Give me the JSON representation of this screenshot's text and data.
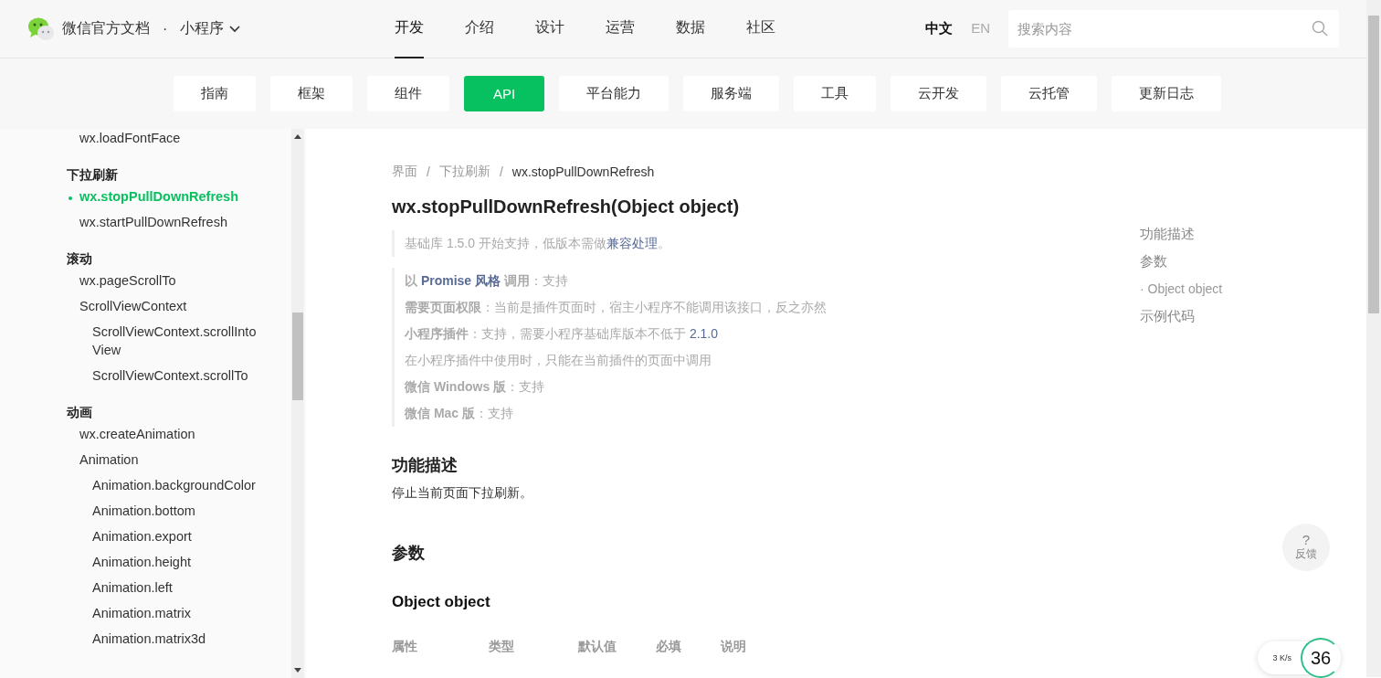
{
  "header": {
    "site_title": "微信官方文档",
    "separator": "·",
    "product": "小程序",
    "nav": [
      {
        "label": "开发",
        "selected": true
      },
      {
        "label": "介绍",
        "selected": false
      },
      {
        "label": "设计",
        "selected": false
      },
      {
        "label": "运营",
        "selected": false
      },
      {
        "label": "数据",
        "selected": false
      },
      {
        "label": "社区",
        "selected": false
      }
    ],
    "languages": [
      {
        "label": "中文",
        "selected": true
      },
      {
        "label": "EN",
        "selected": false
      }
    ],
    "search": {
      "placeholder": "搜索内容"
    }
  },
  "subnav": [
    {
      "label": "指南",
      "selected": false
    },
    {
      "label": "框架",
      "selected": false
    },
    {
      "label": "组件",
      "selected": false
    },
    {
      "label": "API",
      "selected": true
    },
    {
      "label": "平台能力",
      "selected": false
    },
    {
      "label": "服务端",
      "selected": false
    },
    {
      "label": "工具",
      "selected": false
    },
    {
      "label": "云开发",
      "selected": false
    },
    {
      "label": "云托管",
      "selected": false
    },
    {
      "label": "更新日志",
      "selected": false
    }
  ],
  "sidebar": {
    "items": [
      {
        "kind": "item",
        "label": "wx.loadFontFace",
        "selected": false
      },
      {
        "kind": "group",
        "label": "下拉刷新",
        "children": [
          {
            "kind": "item",
            "label": "wx.stopPullDownRefresh",
            "selected": true
          },
          {
            "kind": "item",
            "label": "wx.startPullDownRefresh",
            "selected": false
          }
        ]
      },
      {
        "kind": "group",
        "label": "滚动",
        "children": [
          {
            "kind": "item",
            "label": "wx.pageScrollTo",
            "selected": false
          },
          {
            "kind": "item",
            "label": "ScrollViewContext",
            "selected": false,
            "children": [
              {
                "kind": "item",
                "label": "ScrollViewContext.scrollIntoView",
                "selected": false
              },
              {
                "kind": "item",
                "label": "ScrollViewContext.scrollTo",
                "selected": false
              }
            ]
          }
        ]
      },
      {
        "kind": "group",
        "label": "动画",
        "children": [
          {
            "kind": "item",
            "label": "wx.createAnimation",
            "selected": false
          },
          {
            "kind": "item",
            "label": "Animation",
            "selected": false,
            "children": [
              {
                "kind": "item",
                "label": "Animation.backgroundColor",
                "selected": false
              },
              {
                "kind": "item",
                "label": "Animation.bottom",
                "selected": false
              },
              {
                "kind": "item",
                "label": "Animation.export",
                "selected": false
              },
              {
                "kind": "item",
                "label": "Animation.height",
                "selected": false
              },
              {
                "kind": "item",
                "label": "Animation.left",
                "selected": false
              },
              {
                "kind": "item",
                "label": "Animation.matrix",
                "selected": false
              },
              {
                "kind": "item",
                "label": "Animation.matrix3d",
                "selected": false
              }
            ]
          }
        ]
      }
    ]
  },
  "breadcrumb": [
    {
      "label": "界面",
      "selected": false
    },
    {
      "label": "下拉刷新",
      "selected": false
    },
    {
      "label": "wx.stopPullDownRefresh",
      "selected": true
    }
  ],
  "breadcrumb_separator": "/",
  "title": "wx.stopPullDownRefresh(Object object)",
  "since_note": [
    {
      "kind": "plain",
      "text": "基础库 1.5.0 开始支持，低版本需做"
    },
    {
      "kind": "link",
      "text": "兼容处理"
    },
    {
      "kind": "plain",
      "text": "。"
    }
  ],
  "support_lines": [
    [
      {
        "kind": "bold",
        "text": "以 "
      },
      {
        "kind": "bold-link",
        "text": "Promise 风格"
      },
      {
        "kind": "bold",
        "text": " 调用"
      },
      {
        "kind": "plain",
        "text": "：支持"
      }
    ],
    [
      {
        "kind": "bold",
        "text": "需要页面权限"
      },
      {
        "kind": "plain",
        "text": "：当前是插件页面时，宿主小程序不能调用该接口，反之亦然"
      }
    ],
    [
      {
        "kind": "bold",
        "text": "小程序插件"
      },
      {
        "kind": "plain",
        "text": "：支持，需要小程序基础库版本不低于 "
      },
      {
        "kind": "link",
        "text": "2.1.0"
      }
    ],
    [
      {
        "kind": "plain",
        "text": "在小程序插件中使用时，只能在当前插件的页面中调用"
      }
    ],
    [
      {
        "kind": "bold",
        "text": "微信 Windows 版"
      },
      {
        "kind": "plain",
        "text": "：支持"
      }
    ],
    [
      {
        "kind": "bold",
        "text": "微信 Mac 版"
      },
      {
        "kind": "plain",
        "text": "：支持"
      }
    ]
  ],
  "sections": [
    {
      "kind": "h2",
      "text": "功能描述"
    },
    {
      "kind": "p",
      "text": "停止当前页面下拉刷新。"
    },
    {
      "kind": "h2",
      "text": "参数"
    },
    {
      "kind": "h3",
      "text": "Object object"
    }
  ],
  "table": {
    "columns": [
      "属性",
      "类型",
      "默认值",
      "必填",
      "说明"
    ]
  },
  "toc": [
    {
      "label": "功能描述",
      "sub": false
    },
    {
      "label": "参数",
      "sub": false
    },
    {
      "label": "· Object object",
      "sub": true
    },
    {
      "label": "示例代码",
      "sub": false
    }
  ],
  "feedback": {
    "icon_text": "?",
    "label": "反馈"
  },
  "speed_widget": {
    "rate": "3 K/s",
    "value": "36"
  }
}
